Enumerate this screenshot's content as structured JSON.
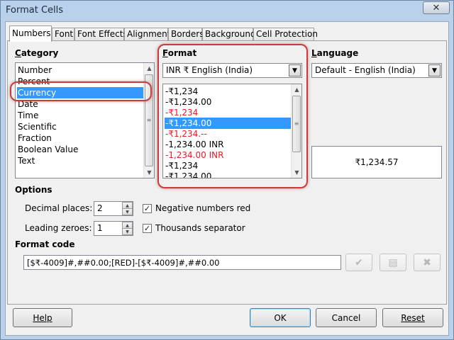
{
  "window": {
    "title": "Format Cells",
    "close_icon": "✕"
  },
  "tabs": [
    {
      "label": "Numbers",
      "active": true
    },
    {
      "label": "Font"
    },
    {
      "label": "Font Effects"
    },
    {
      "label": "Alignment"
    },
    {
      "label": "Borders"
    },
    {
      "label": "Background"
    },
    {
      "label": "Cell Protection"
    }
  ],
  "category": {
    "heading": "Category",
    "items": [
      "Number",
      "Percent",
      "Currency",
      "Date",
      "Time",
      "Scientific",
      "Fraction",
      "Boolean Value",
      "Text"
    ],
    "selected": "Currency"
  },
  "format": {
    "heading": "Format",
    "currency_value": "INR ₹ English (India)",
    "items": [
      {
        "text": "-₹1,234",
        "red": false
      },
      {
        "text": "-₹1,234.00",
        "red": false
      },
      {
        "text": "-₹1,234",
        "red": true
      },
      {
        "text": "-₹1,234.00",
        "red": false,
        "selected": true
      },
      {
        "text": "-₹1,234.--",
        "red": true
      },
      {
        "text": "-1,234.00 INR",
        "red": false
      },
      {
        "text": "-1,234.00 INR",
        "red": true
      },
      {
        "text": "-₹1,234",
        "red": false
      },
      {
        "text": "-₹1,234.00",
        "red": false
      }
    ]
  },
  "language": {
    "heading": "Language",
    "value": "Default - English (India)",
    "preview": "₹1,234.57"
  },
  "options": {
    "heading": "Options",
    "decimal_places_label": "Decimal places:",
    "decimal_places": "2",
    "leading_zeroes_label": "Leading zeroes:",
    "leading_zeroes": "1",
    "negative_red_label": "Negative numbers red",
    "negative_red": true,
    "thousands_label": "Thousands separator",
    "thousands": true
  },
  "format_code": {
    "heading": "Format code",
    "value": "[$₹-4009]#,##0.00;[RED]-[$₹-4009]#,##0.00"
  },
  "buttons": {
    "help": "Help",
    "ok": "OK",
    "cancel": "Cancel",
    "reset": "Reset"
  }
}
